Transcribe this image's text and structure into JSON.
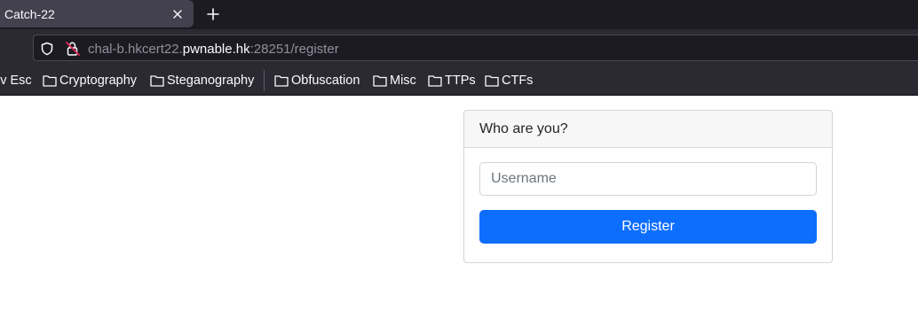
{
  "browser": {
    "tab": {
      "title": "Catch-22"
    },
    "url": {
      "prefix": "chal-b.hkcert22.",
      "domain": "pwnable.hk",
      "suffix": ":28251/register"
    },
    "bookmarks": [
      {
        "label": "iv Esc",
        "icon": "none"
      },
      {
        "label": "Cryptography",
        "icon": "folder-icon"
      },
      {
        "label": "Steganography",
        "icon": "folder-icon"
      },
      {
        "label": "Obfuscation",
        "icon": "folder-icon"
      },
      {
        "label": "Misc",
        "icon": "folder-icon"
      },
      {
        "label": "TTPs",
        "icon": "folder-icon"
      },
      {
        "label": "CTFs",
        "icon": "folder-icon"
      }
    ]
  },
  "page": {
    "card": {
      "title": "Who are you?",
      "username_placeholder": "Username",
      "register_label": "Register"
    }
  },
  "colors": {
    "primary": "#0d6efd",
    "browser_dark": "#1c1b22",
    "browser_toolbar": "#2b2a33"
  }
}
